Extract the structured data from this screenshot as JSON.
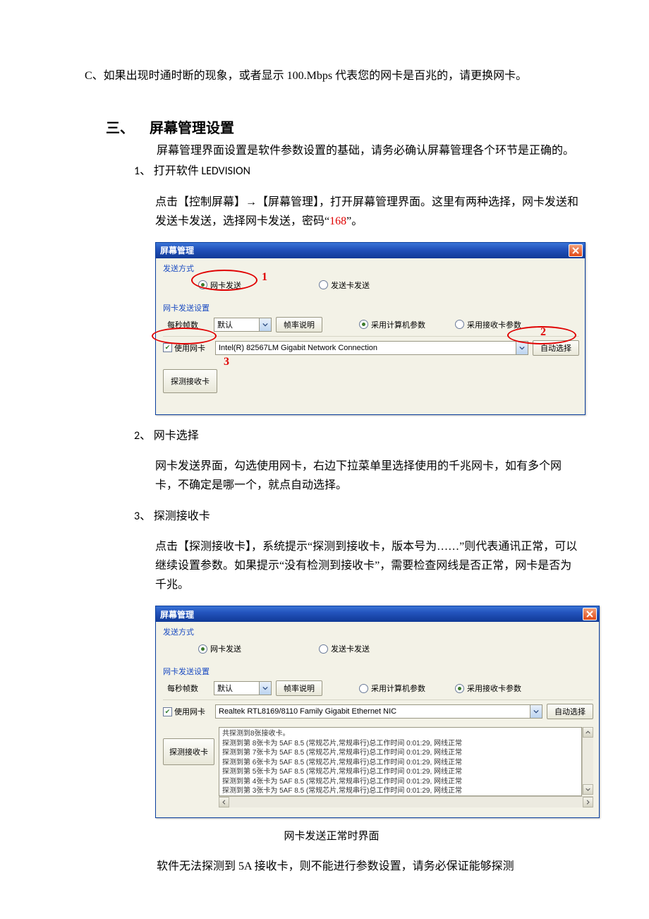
{
  "intro": {
    "c_text": "C、如果出现时通时断的现象，或者显示 100.Mbps 代表您的网卡是百兆的，请更换网卡。"
  },
  "section3": {
    "num": "三、",
    "title": "屏幕管理设置",
    "lead": "屏幕管理界面设置是软件参数设置的基础，请务必确认屏幕管理各个环节是正确的。",
    "item1_head": "1、 打开软件 LEDVISION",
    "item1_body_a": "点击【控制屏幕】→【屏幕管理】，打开屏幕管理界面。这里有两种选择，网卡发送和发送卡发送，选择网卡发送，密码“",
    "item1_body_pw": "168",
    "item1_body_b": "”。",
    "item2_head": "2、 网卡选择",
    "item2_body": "网卡发送界面，勾选使用网卡，右边下拉菜单里选择使用的千兆网卡，如有多个网卡，不确定是哪一个，就点自动选择。",
    "item3_head": "3、 探测接收卡",
    "item3_body": "点击【探测接收卡】，系统提示“探测到接收卡，版本号为……”则代表通讯正常，可以继续设置参数。如果提示“没有检测到接收卡”，需要检查网线是否正常，网卡是否为千兆。",
    "caption": "网卡发送正常时界面",
    "footer": "软件无法探测到 5A 接收卡，则不能进行参数设置，请务必保证能够探测"
  },
  "win1": {
    "title": "屏幕管理",
    "send_mode": "发送方式",
    "opt_nic": "网卡发送",
    "opt_card": "发送卡发送",
    "nic_settings": "网卡发送设置",
    "fps_label": "每秒帧数",
    "fps_value": "默认",
    "fps_info_btn": "帧率说明",
    "param_pc": "采用计算机参数",
    "param_rx": "采用接收卡参数",
    "use_nic": "使用网卡",
    "nic_value": "Intel(R) 82567LM Gigabit Network Connection",
    "auto_btn": "自动选择",
    "detect_btn": "探测接收卡",
    "marks": {
      "m1": "1",
      "m2": "2",
      "m3": "3"
    }
  },
  "win2": {
    "title": "屏幕管理",
    "send_mode": "发送方式",
    "opt_nic": "网卡发送",
    "opt_card": "发送卡发送",
    "nic_settings": "网卡发送设置",
    "fps_label": "每秒帧数",
    "fps_value": "默认",
    "fps_info_btn": "帧率说明",
    "param_pc": "采用计算机参数",
    "param_rx": "采用接收卡参数",
    "use_nic": "使用网卡",
    "nic_value": "Realtek RTL8169/8110 Family Gigabit Ethernet NIC",
    "auto_btn": "自动选择",
    "detect_btn": "探测接收卡",
    "log_header": "共探测到8张接收卡。",
    "log_lines": [
      "探测到第 8张卡为 5AF 8.5 (常规芯片,常规串行)总工作时间 0:01:29, 网线正常",
      "探测到第 7张卡为 5AF 8.5 (常规芯片,常规串行)总工作时间 0:01:29, 网线正常",
      "探测到第 6张卡为 5AF 8.5 (常规芯片,常规串行)总工作时间 0:01:29, 网线正常",
      "探测到第 5张卡为 5AF 8.5 (常规芯片,常规串行)总工作时间 0:01:29, 网线正常",
      "探测到第 4张卡为 5AF 8.5 (常规芯片,常规串行)总工作时间 0:01:29, 网线正常",
      "探测到第 3张卡为 5AF 8.5 (常规芯片,常规串行)总工作时间 0:01:29, 网线正常"
    ]
  }
}
